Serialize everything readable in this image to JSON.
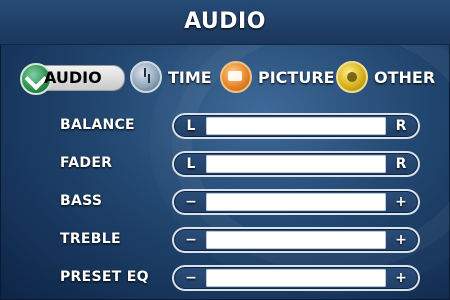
{
  "window": {
    "title": "AUDIO"
  },
  "tabs": [
    {
      "label": "AUDIO",
      "icon": "audio-icon",
      "active": true
    },
    {
      "label": "TIME",
      "icon": "time-icon",
      "active": false
    },
    {
      "label": "PICTURE",
      "icon": "picture-icon",
      "active": false
    },
    {
      "label": "OTHER",
      "icon": "other-icon",
      "active": false
    }
  ],
  "settings": [
    {
      "label": "BALANCE",
      "left": "L",
      "right": "R"
    },
    {
      "label": "FADER",
      "left": "L",
      "right": "R"
    },
    {
      "label": "BASS",
      "left": "−",
      "right": "+"
    },
    {
      "label": "TREBLE",
      "left": "−",
      "right": "+"
    },
    {
      "label": "PRESET EQ",
      "left": "−",
      "right": "+"
    }
  ],
  "colors": {
    "background": "#21466f",
    "title_bar": "#264b78",
    "active_tab_bg": "#e6e6e6",
    "text": "#ffffff",
    "control_border": "#d9e1ea"
  }
}
